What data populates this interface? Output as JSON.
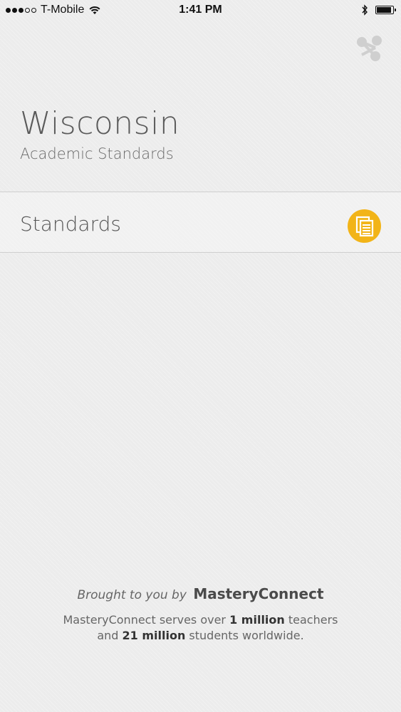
{
  "status_bar": {
    "signal_dots_full": 3,
    "signal_dots_total": 5,
    "carrier": "T-Mobile",
    "time": "1:41 PM",
    "battery_level": 0.95
  },
  "header": {
    "title": "Wisconsin",
    "subtitle": "Academic Standards",
    "share_icon": "share-icon"
  },
  "list": {
    "items": [
      {
        "label": "Standards",
        "icon": "documents-icon",
        "icon_color": "#f2b418"
      }
    ]
  },
  "footer": {
    "brought_prefix": "Brought to you by",
    "brand": "MasteryConnect",
    "line1_pre": "MasteryConnect serves over ",
    "line1_bold": "1 million",
    "line1_post": " teachers",
    "line2_pre": "and ",
    "line2_bold": "21 million",
    "line2_post": " students worldwide."
  },
  "colors": {
    "background": "#ececec",
    "accent": "#f2b418",
    "text": "#555555"
  }
}
